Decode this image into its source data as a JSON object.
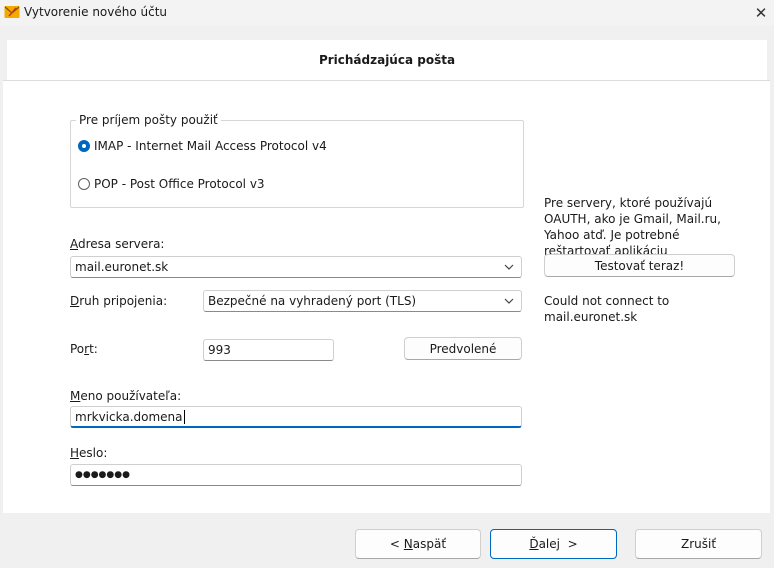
{
  "window": {
    "title": "Vytvorenie nového účtu",
    "close_glyph": "✕",
    "app_icon": "envelope-app-icon"
  },
  "header": {
    "title": "Prichádzajúca pošta"
  },
  "protocol_group": {
    "legend": "Pre príjem pošty použiť",
    "options": [
      {
        "label": "IMAP - Internet Mail Access Protocol v4",
        "selected": true
      },
      {
        "label": "POP - Post Office Protocol v3",
        "selected": false
      }
    ]
  },
  "server": {
    "label_first": "A",
    "label_rest": "dresa servera:",
    "value": "mail.euronet.sk"
  },
  "connection": {
    "label_first": "D",
    "label_rest": "ruh pripojenia:",
    "value": "Bezpečné na vyhradený port (TLS)"
  },
  "port": {
    "label_a": "Po",
    "label_u": "r",
    "label_b": "t:",
    "value": "993",
    "default_button": "Predvolené"
  },
  "username": {
    "label_first": "M",
    "label_rest": "eno používateľa:",
    "value": "mrkvicka.domena"
  },
  "password": {
    "label_first": "H",
    "label_rest": "eslo:",
    "value": "●●●●●●●"
  },
  "oauth": {
    "note": "Pre servery, ktoré používajú OAUTH, ako je Gmail, Mail.ru, Yahoo atď. Je potrebné reštartovať aplikáciu",
    "test_button": "Testovať teraz!",
    "status_line1": "Could not connect to",
    "status_line2": "mail.euronet.sk"
  },
  "footer": {
    "back_prefix": "< ",
    "back_u": "N",
    "back_rest": "aspäť",
    "next_u": "Ď",
    "next_rest": "alej",
    "next_suffix": "  >",
    "cancel": "Zrušiť"
  },
  "colors": {
    "accent": "#0067c0",
    "panel": "#ffffff",
    "background": "#f0f0f0"
  }
}
